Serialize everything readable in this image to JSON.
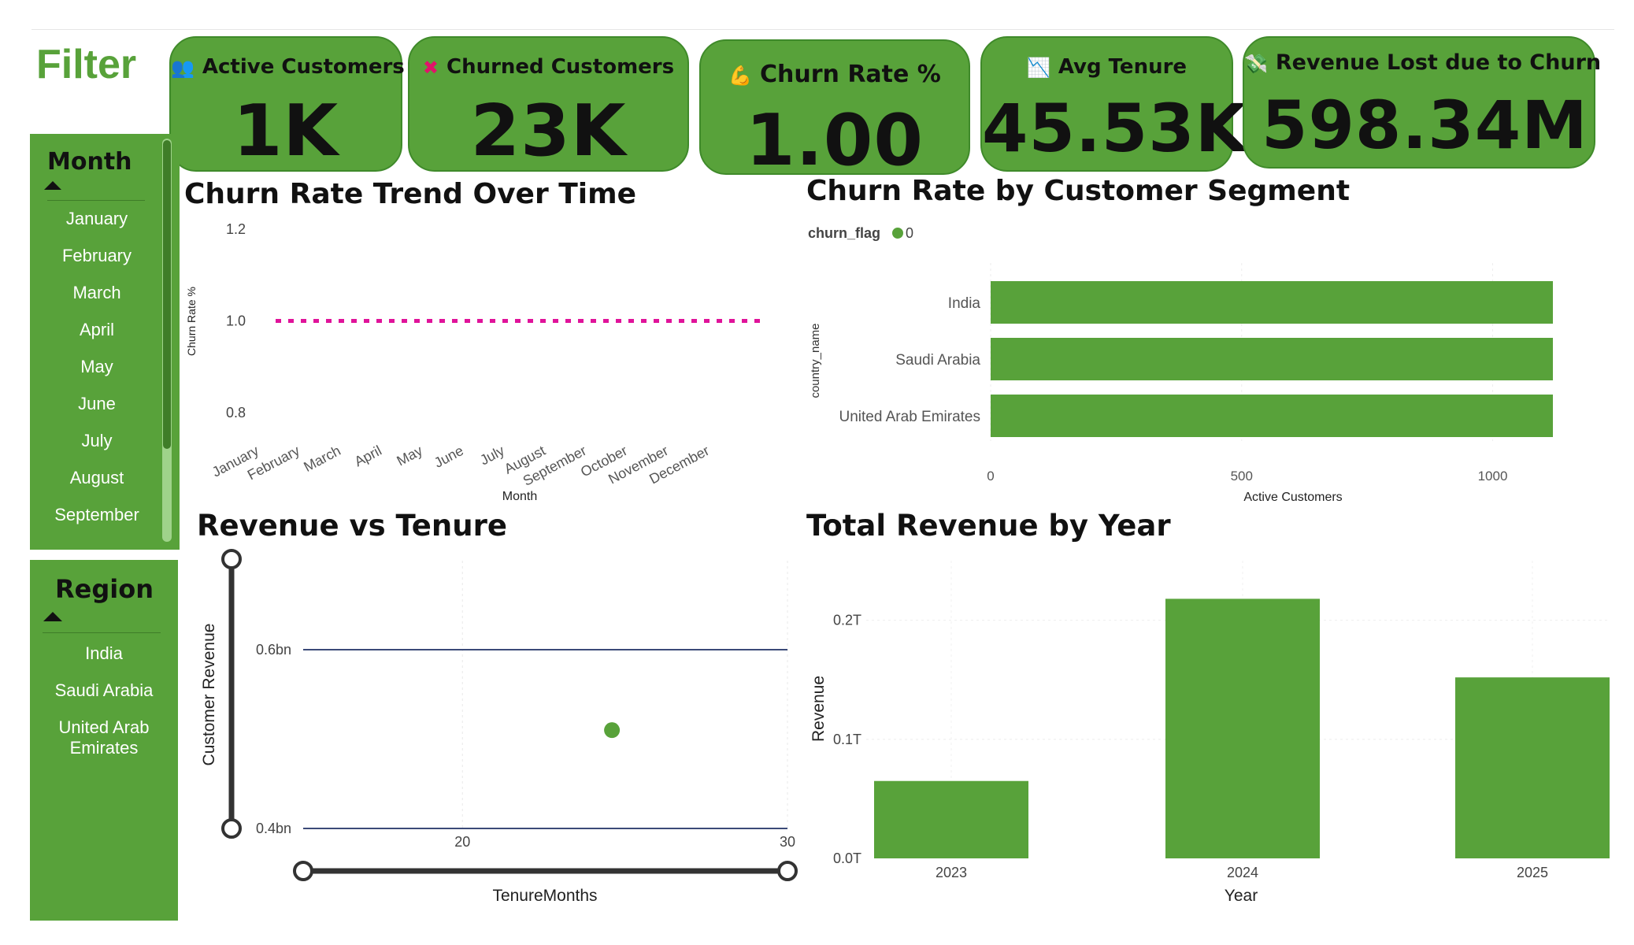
{
  "filter_title": "Filter",
  "kpis": [
    {
      "label": "Active Customers",
      "value": "1K",
      "icon": "users-icon"
    },
    {
      "label": "Churned Customers",
      "value": "23K",
      "icon": "cross-icon"
    },
    {
      "label": "Churn Rate %",
      "value": "1.00",
      "icon": "flexed-arm-icon"
    },
    {
      "label": "Avg Tenure",
      "value": "45.53K",
      "icon": "chart-decreasing-icon"
    },
    {
      "label": "Revenue Lost due to Churn",
      "value": "598.34M",
      "icon": "money-wings-icon"
    }
  ],
  "month_slicer": {
    "title": "Month",
    "items": [
      "January",
      "February",
      "March",
      "April",
      "May",
      "June",
      "July",
      "August",
      "September"
    ]
  },
  "region_slicer": {
    "title": "Region",
    "items": [
      "India",
      "Saudi Arabia",
      "United Arab Emirates"
    ]
  },
  "colors": {
    "green": "#58a23a",
    "pink_line": "#e0139a",
    "navy_line": "#3b4a78",
    "dark": "#333333"
  },
  "charts": [
    {
      "id": "churn_trend",
      "title": "Churn Rate Trend Over Time",
      "type": "line",
      "xlabel": "Month",
      "ylabel": "Churn Rate %",
      "categories": [
        "January",
        "February",
        "March",
        "April",
        "May",
        "June",
        "July",
        "August",
        "September",
        "October",
        "November",
        "December"
      ],
      "series": [
        {
          "values": [
            1,
            1,
            1,
            1,
            1,
            1,
            1,
            1,
            1,
            1,
            1,
            1
          ]
        }
      ],
      "yticks": [
        "0.8",
        "1.0",
        "1.2"
      ],
      "ylim": [
        0.8,
        1.2
      ],
      "line_style": "dotted"
    },
    {
      "id": "churn_segment",
      "title": "Churn Rate by Customer Segment",
      "type": "bar",
      "orientation": "horizontal",
      "legend_title": "churn_flag",
      "legend_items": [
        "0"
      ],
      "xlabel": "Active Customers",
      "ylabel": "country_name",
      "categories": [
        "India",
        "Saudi Arabia",
        "United Arab Emirates"
      ],
      "values": [
        1120,
        1120,
        1120
      ],
      "xticks": [
        "0",
        "500",
        "1000"
      ],
      "xlim": [
        0,
        1120
      ]
    },
    {
      "id": "revenue_tenure",
      "title": "Revenue vs Tenure",
      "type": "scatter",
      "xlabel": "TenureMonths",
      "ylabel": "Customer Revenue",
      "points": [
        {
          "x": 24.6,
          "y": 0.51
        }
      ],
      "xticks": [
        "20",
        "30"
      ],
      "yticks": [
        "0.4bn",
        "0.6bn"
      ],
      "xlim": [
        15.1,
        30
      ],
      "ylim": [
        0.4,
        0.6
      ]
    },
    {
      "id": "revenue_year",
      "title": "Total Revenue by Year",
      "type": "bar",
      "xlabel": "Year",
      "ylabel": "Revenue",
      "categories": [
        "2023",
        "2024",
        "2025"
      ],
      "values": [
        0.065,
        0.218,
        0.152
      ],
      "yticks": [
        "0.0T",
        "0.1T",
        "0.2T"
      ],
      "ylim": [
        0,
        0.25
      ]
    }
  ]
}
